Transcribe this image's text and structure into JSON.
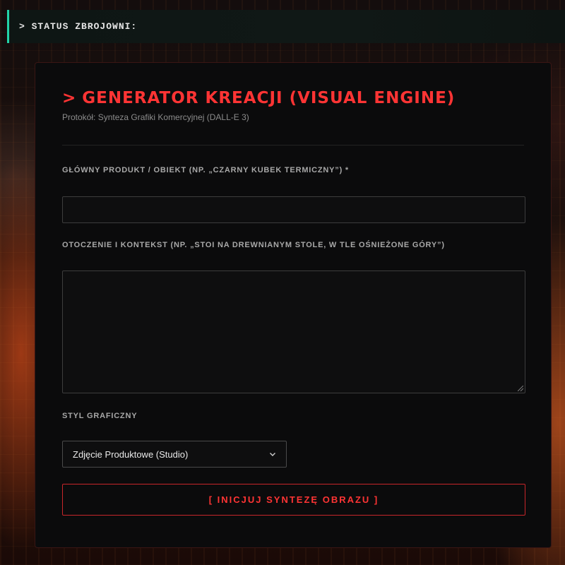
{
  "status_bar": {
    "text": "> STATUS ZBROJOWNI:"
  },
  "panel": {
    "title_prefix": ">",
    "title": "GENERATOR KREACJI (VISUAL ENGINE)",
    "subtitle": "Protokół: Synteza Grafiki Komercyjnej (DALL-E 3)"
  },
  "form": {
    "product_label": "GŁÓWNY PRODUKT / OBIEKT (NP. „CZARNY KUBEK TERMICZNY”) *",
    "product_value": "",
    "context_label": "OTOCZENIE I KONTEKST (NP. „STOI NA DREWNIANYM STOLE, W TLE OŚNIEŻONE GÓRY”)",
    "context_value": "",
    "style_label": "STYL GRAFICZNY",
    "style_selected": "Zdjęcie Produktowe (Studio)",
    "submit_label": "[ INICJUJ SYNTEZĘ OBRAZU ]"
  },
  "colors": {
    "accent": "#ff3434",
    "status_border": "#22d3a8",
    "panel_bg": "#0b0b0c"
  }
}
